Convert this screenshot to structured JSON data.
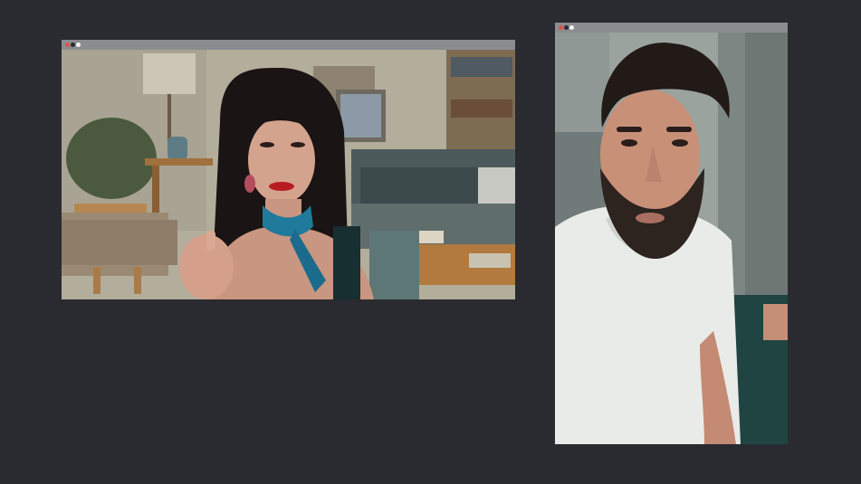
{
  "theme": {
    "background": "#2a2b30",
    "titlebar": "#8b8c90",
    "dot_close": "#e0524a",
    "dot_min": "#2a2b30",
    "dot_max": "#f2f2f2"
  },
  "windows": [
    {
      "name": "video-call-window-left",
      "feed": "woman-video-feed"
    },
    {
      "name": "video-call-window-right",
      "feed": "man-video-feed"
    }
  ]
}
